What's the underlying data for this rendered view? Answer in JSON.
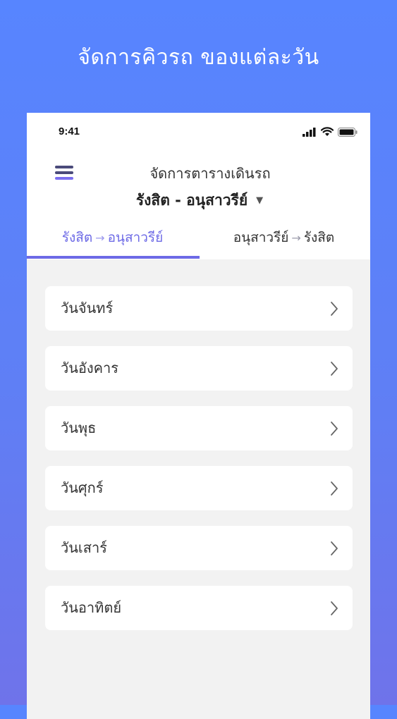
{
  "headline": "จัดการคิวรถ ของแต่ละวัน",
  "status": {
    "time": "9:41",
    "icons": [
      "signal-icon",
      "wifi-icon",
      "battery-icon"
    ]
  },
  "header": {
    "title": "จัดการตารางเดินรถ",
    "route": "รังสิต - อนุสาวรีย์",
    "route_caret": "▼"
  },
  "tabs": [
    {
      "from": "รังสิต",
      "arrow": "→",
      "to": "อนุสาวรีย์",
      "active": true
    },
    {
      "from": "อนุสาวรีย์",
      "arrow": "→",
      "to": "รังสิต",
      "active": false
    }
  ],
  "days": [
    {
      "label": "วันจันทร์"
    },
    {
      "label": "วันอังคาร"
    },
    {
      "label": "วันพุธ"
    },
    {
      "label": "วันศุกร์"
    },
    {
      "label": "วันเสาร์"
    },
    {
      "label": "วันอาทิตย์"
    }
  ],
  "colors": {
    "accent": "#6d6ae6",
    "background_top": "#5785ff",
    "background_bottom": "#6f73ea"
  }
}
